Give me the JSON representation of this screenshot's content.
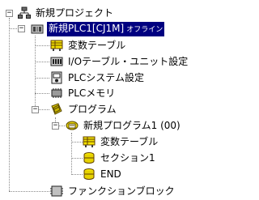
{
  "tree": {
    "root": {
      "label": "新規プロジェクト",
      "expander": "−"
    },
    "plc": {
      "label": "新規PLC1[CJ1M]",
      "status": "オフライン",
      "expander": "−"
    },
    "items": [
      {
        "label": "変数テーブル"
      },
      {
        "label": "I/Oテーブル・ユニット設定"
      },
      {
        "label": "PLCシステム設定"
      },
      {
        "label": "PLCメモリ"
      }
    ],
    "programs": {
      "label": "プログラム",
      "expander": "−"
    },
    "program1": {
      "label": "新規プログラム1 (00)",
      "expander": "−"
    },
    "program_items": [
      {
        "label": "変数テーブル"
      },
      {
        "label": "セクション1"
      },
      {
        "label": "END"
      }
    ],
    "function_blocks": {
      "label": "ファンクションブロック",
      "expander": "+"
    }
  },
  "colors": {
    "selection_bg": "#000080",
    "selection_fg": "#ffffff",
    "tree_lines": "#8a8a8a"
  }
}
